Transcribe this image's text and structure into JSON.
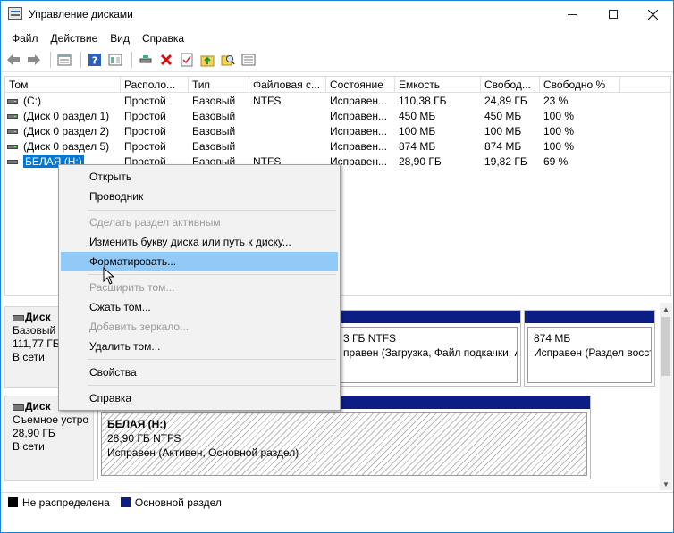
{
  "window": {
    "title": "Управление дисками"
  },
  "menu": [
    "Файл",
    "Действие",
    "Вид",
    "Справка"
  ],
  "toolbar_icons": [
    "back-arrow-icon",
    "forward-arrow-icon",
    "properties-icon",
    "help-icon",
    "view-icon",
    "connect-icon",
    "delete-icon",
    "checklist-icon",
    "up-folder-icon",
    "search-folder-icon",
    "list-icon"
  ],
  "columns": [
    "Том",
    "Располо...",
    "Тип",
    "Файловая с...",
    "Состояние",
    "Емкость",
    "Свобод...",
    "Свободно %"
  ],
  "volumes": [
    {
      "name": "(C:)",
      "layout": "Простой",
      "type": "Базовый",
      "fs": "NTFS",
      "status": "Исправен...",
      "capacity": "110,38 ГБ",
      "free": "24,89 ГБ",
      "free_pct": "23 %"
    },
    {
      "name": "(Диск 0 раздел 1)",
      "layout": "Простой",
      "type": "Базовый",
      "fs": "",
      "status": "Исправен...",
      "capacity": "450 МБ",
      "free": "450 МБ",
      "free_pct": "100 %"
    },
    {
      "name": "(Диск 0 раздел 2)",
      "layout": "Простой",
      "type": "Базовый",
      "fs": "",
      "status": "Исправен...",
      "capacity": "100 МБ",
      "free": "100 МБ",
      "free_pct": "100 %"
    },
    {
      "name": "(Диск 0 раздел 5)",
      "layout": "Простой",
      "type": "Базовый",
      "fs": "",
      "status": "Исправен...",
      "capacity": "874 МБ",
      "free": "874 МБ",
      "free_pct": "100 %"
    },
    {
      "name": "БЕЛАЯ (H:)",
      "layout": "Простой",
      "type": "Базовый",
      "fs": "NTFS",
      "status": "Исправен...",
      "capacity": "28,90 ГБ",
      "free": "19,82 ГБ",
      "free_pct": "69 %"
    }
  ],
  "disks": [
    {
      "name": "Диск 0",
      "name_visible": "Диск",
      "kind": "Базовый",
      "size": "111,77 ГБ",
      "state": "В сети"
    },
    {
      "name": "Диск 1",
      "name_visible": "Диск",
      "kind": "Съемное устро",
      "size": "28,90 ГБ",
      "state": "В сети"
    }
  ],
  "disk0_parts": [
    {
      "line1": "",
      "line2": "3 ГБ NTFS",
      "line3": "правен (Загрузка, Файл подкачки, Авар"
    },
    {
      "line1": "",
      "line2": "874 МБ",
      "line3": "Исправен (Раздел восст"
    }
  ],
  "disk1_part": {
    "line1": "БЕЛАЯ  (H:)",
    "line2": "28,90 ГБ NTFS",
    "line3": "Исправен (Активен, Основной раздел)"
  },
  "legend": [
    {
      "label": "Не распределена",
      "color": "#000000"
    },
    {
      "label": "Основной раздел",
      "color": "#0c1e84"
    }
  ],
  "context_menu": {
    "items": [
      {
        "label": "Открыть",
        "enabled": true
      },
      {
        "label": "Проводник",
        "enabled": true
      },
      {
        "label": "Сделать раздел активным",
        "enabled": false
      },
      {
        "label": "Изменить букву диска или путь к диску...",
        "enabled": true
      },
      {
        "label": "Форматировать...",
        "enabled": true,
        "highlighted": true
      },
      {
        "label": "Расширить том...",
        "enabled": false
      },
      {
        "label": "Сжать том...",
        "enabled": true
      },
      {
        "label": "Добавить зеркало...",
        "enabled": false
      },
      {
        "label": "Удалить том...",
        "enabled": true
      },
      {
        "label": "Свойства",
        "enabled": true
      },
      {
        "label": "Справка",
        "enabled": true
      }
    ]
  },
  "colors": {
    "accent": "#0078d7",
    "primary_partition": "#0c1e84",
    "menu_highlight": "#91c9f7"
  }
}
